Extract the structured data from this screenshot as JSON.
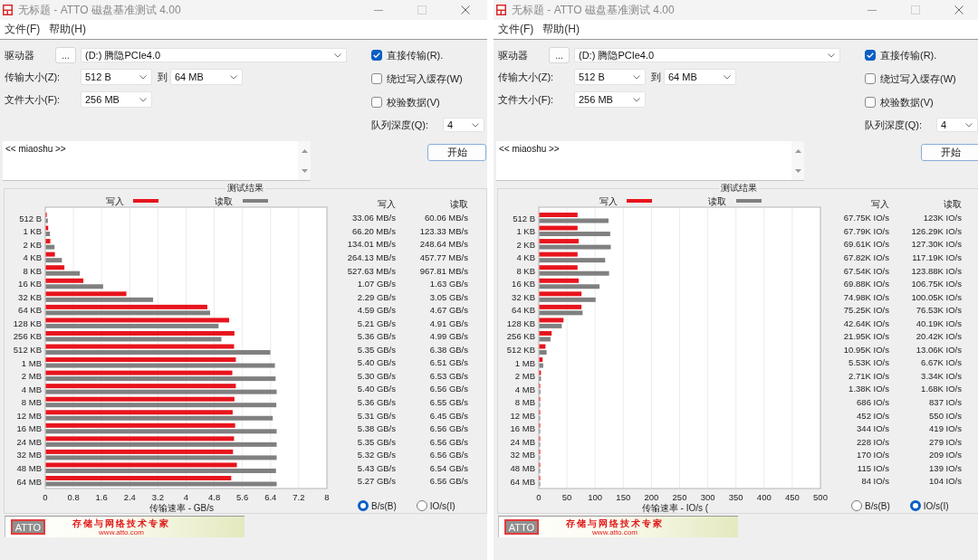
{
  "windows": [
    {
      "title": "无标题 - ATTO 磁盘基准测试 4.00",
      "menu": [
        "文件(F)",
        "帮助(H)"
      ],
      "drive": {
        "label": "驱动器",
        "browse_button": "...",
        "value": "(D:) 腾隐PCIe4.0"
      },
      "transfer_size": {
        "label": "传输大小(Z):",
        "from": "512 B",
        "to_label": "到",
        "to": "64 MB"
      },
      "file_size": {
        "label": "文件大小(F):",
        "value": "256 MB"
      },
      "options": [
        {
          "label": "直接传输(R).",
          "checked": true
        },
        {
          "label": "绕过写入缓存(W)",
          "checked": false
        },
        {
          "label": "校验数据(V)",
          "checked": false
        }
      ],
      "queue_depth": {
        "label": "队列深度(Q):",
        "value": "4"
      },
      "description": "<< miaoshu >>",
      "start_button": "开始",
      "results": {
        "title": "测试结果",
        "chart_data": [
          {
            "type": "bar",
            "orientation": "horizontal",
            "xlabel": "传输速率 - GB/s",
            "legend": "top",
            "grid": true,
            "xlim": [
              0,
              8
            ],
            "xticks": [
              0,
              0.8,
              1.6,
              2.4,
              3.2,
              4,
              4.8,
              5.6,
              6.4,
              7.2,
              8
            ],
            "categories": [
              "512 B",
              "1 KB",
              "2 KB",
              "4 KB",
              "8 KB",
              "16 KB",
              "32 KB",
              "64 KB",
              "128 KB",
              "256 KB",
              "512 KB",
              "1 MB",
              "2 MB",
              "4 MB",
              "8 MB",
              "12 MB",
              "16 MB",
              "24 MB",
              "32 MB",
              "48 MB",
              "64 MB"
            ],
            "series": [
              {
                "name": "写入",
                "color": "#e8141c",
                "values": [
                  0.03,
                  0.07,
                  0.13,
                  0.26,
                  0.53,
                  1.07,
                  2.29,
                  4.59,
                  5.21,
                  5.36,
                  5.35,
                  5.4,
                  5.3,
                  5.4,
                  5.36,
                  5.31,
                  5.38,
                  5.35,
                  5.32,
                  5.43,
                  5.27
                ]
              },
              {
                "name": "读取",
                "color": "#808080",
                "values": [
                  0.06,
                  0.12,
                  0.25,
                  0.46,
                  0.97,
                  1.63,
                  3.05,
                  4.67,
                  4.91,
                  4.99,
                  6.38,
                  6.51,
                  6.53,
                  6.56,
                  6.55,
                  6.45,
                  6.56,
                  6.56,
                  6.56,
                  6.54,
                  6.56
                ]
              }
            ]
          }
        ],
        "columns": [
          "写入",
          "读取"
        ],
        "rows": [
          [
            "33.06 MB/s",
            "60.06 MB/s"
          ],
          [
            "66.20 MB/s",
            "123.33 MB/s"
          ],
          [
            "134.01 MB/s",
            "248.64 MB/s"
          ],
          [
            "264.13 MB/s",
            "457.77 MB/s"
          ],
          [
            "527.63 MB/s",
            "967.81 MB/s"
          ],
          [
            "1.07 GB/s",
            "1.63 GB/s"
          ],
          [
            "2.29 GB/s",
            "3.05 GB/s"
          ],
          [
            "4.59 GB/s",
            "4.67 GB/s"
          ],
          [
            "5.21 GB/s",
            "4.91 GB/s"
          ],
          [
            "5.36 GB/s",
            "4.99 GB/s"
          ],
          [
            "5.35 GB/s",
            "6.38 GB/s"
          ],
          [
            "5.40 GB/s",
            "6.51 GB/s"
          ],
          [
            "5.30 GB/s",
            "6.53 GB/s"
          ],
          [
            "5.40 GB/s",
            "6.56 GB/s"
          ],
          [
            "5.36 GB/s",
            "6.55 GB/s"
          ],
          [
            "5.31 GB/s",
            "6.45 GB/s"
          ],
          [
            "5.38 GB/s",
            "6.56 GB/s"
          ],
          [
            "5.35 GB/s",
            "6.56 GB/s"
          ],
          [
            "5.32 GB/s",
            "6.56 GB/s"
          ],
          [
            "5.43 GB/s",
            "6.54 GB/s"
          ],
          [
            "5.27 GB/s",
            "6.56 GB/s"
          ]
        ],
        "units": [
          {
            "label": "B/s(B)",
            "selected": true
          },
          {
            "label": "IO/s(I)",
            "selected": false
          }
        ]
      },
      "banner": {
        "logo": "ATTO",
        "slogan": "存储与网络技术专家",
        "url": "www.atto.com"
      }
    },
    {
      "title": "无标题 - ATTO 磁盘基准测试 4.00",
      "menu": [
        "文件(F)",
        "帮助(H)"
      ],
      "drive": {
        "label": "驱动器",
        "browse_button": "...",
        "value": "(D:) 腾隐PCIe4.0"
      },
      "transfer_size": {
        "label": "传输大小(Z):",
        "from": "512 B",
        "to_label": "到",
        "to": "64 MB"
      },
      "file_size": {
        "label": "文件大小(F):",
        "value": "256 MB"
      },
      "options": [
        {
          "label": "直接传输(R).",
          "checked": true
        },
        {
          "label": "绕过写入缓存(W)",
          "checked": false
        },
        {
          "label": "校验数据(V)",
          "checked": false
        }
      ],
      "queue_depth": {
        "label": "队列深度(Q):",
        "value": "4"
      },
      "description": "<< miaoshu >>",
      "start_button": "开始",
      "results": {
        "title": "测试结果",
        "chart_data": [
          {
            "type": "bar",
            "orientation": "horizontal",
            "xlabel": "传输速率 - IO/s (",
            "legend": "top",
            "grid": true,
            "xlim": [
              0,
              500
            ],
            "xticks": [
              0,
              50,
              100,
              150,
              200,
              250,
              300,
              350,
              400,
              450,
              500
            ],
            "categories": [
              "512 B",
              "1 KB",
              "2 KB",
              "4 KB",
              "8 KB",
              "16 KB",
              "32 KB",
              "64 KB",
              "128 KB",
              "256 KB",
              "512 KB",
              "1 MB",
              "2 MB",
              "4 MB",
              "8 MB",
              "12 MB",
              "16 MB",
              "24 MB",
              "32 MB",
              "48 MB",
              "64 MB"
            ],
            "series": [
              {
                "name": "写入",
                "color": "#e8141c",
                "values": [
                  68,
                  68,
                  70,
                  68,
                  68,
                  70,
                  75,
                  75,
                  43,
                  22,
                  11,
                  6,
                  3,
                  1,
                  1,
                  0,
                  0,
                  0,
                  0,
                  0,
                  0
                ]
              },
              {
                "name": "读取",
                "color": "#808080",
                "values": [
                  123,
                  126,
                  127,
                  117,
                  124,
                  107,
                  100,
                  77,
                  40,
                  20,
                  13,
                  7,
                  3,
                  2,
                  1,
                  1,
                  0,
                  0,
                  0,
                  0,
                  0
                ]
              }
            ]
          }
        ],
        "columns": [
          "写入",
          "读取"
        ],
        "rows": [
          [
            "67.75K IO/s",
            "123K IO/s"
          ],
          [
            "67.79K IO/s",
            "126.29K IO/s"
          ],
          [
            "69.61K IO/s",
            "127.30K IO/s"
          ],
          [
            "67.82K IO/s",
            "117.19K IO/s"
          ],
          [
            "67.54K IO/s",
            "123.88K IO/s"
          ],
          [
            "69.88K IO/s",
            "106.75K IO/s"
          ],
          [
            "74.98K IO/s",
            "100.05K IO/s"
          ],
          [
            "75.25K IO/s",
            "76.53K IO/s"
          ],
          [
            "42.64K IO/s",
            "40.19K IO/s"
          ],
          [
            "21.95K IO/s",
            "20.42K IO/s"
          ],
          [
            "10.95K IO/s",
            "13.06K IO/s"
          ],
          [
            "5.53K IO/s",
            "6.67K IO/s"
          ],
          [
            "2.71K IO/s",
            "3.34K IO/s"
          ],
          [
            "1.38K IO/s",
            "1.68K IO/s"
          ],
          [
            "686 IO/s",
            "837 IO/s"
          ],
          [
            "452 IO/s",
            "550 IO/s"
          ],
          [
            "344 IO/s",
            "419 IO/s"
          ],
          [
            "228 IO/s",
            "279 IO/s"
          ],
          [
            "170 IO/s",
            "209 IO/s"
          ],
          [
            "115 IO/s",
            "139 IO/s"
          ],
          [
            "84 IO/s",
            "104 IO/s"
          ]
        ],
        "units": [
          {
            "label": "B/s(B)",
            "selected": false
          },
          {
            "label": "IO/s(I)",
            "selected": true
          }
        ]
      },
      "banner": {
        "logo": "ATTO",
        "slogan": "存储与网络技术专家",
        "url": "www.atto.com"
      }
    }
  ]
}
